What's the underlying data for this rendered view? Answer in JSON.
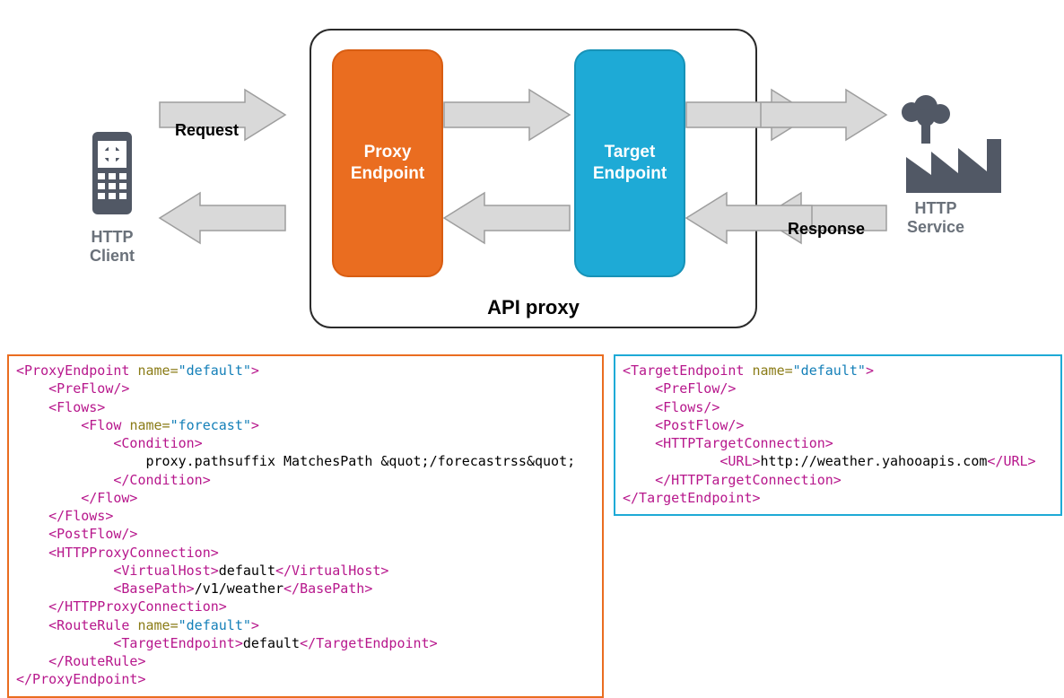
{
  "diagram": {
    "client_label": "HTTP\nClient",
    "service_label": "HTTP\nService",
    "request_label": "Request",
    "response_label": "Response",
    "proxy_box": "Proxy\nEndpoint",
    "target_box": "Target\nEndpoint",
    "api_proxy_label": "API proxy"
  },
  "colors": {
    "proxy": "#ea6d20",
    "target": "#1eaad6",
    "icon_gray": "#515865",
    "arrow_fill": "#d9d9d9",
    "arrow_stroke": "#9e9e9e"
  },
  "proxy_code": [
    {
      "indent": 0,
      "seg": [
        {
          "c": "t",
          "v": "<ProxyEndpoint "
        },
        {
          "c": "an",
          "v": "name="
        },
        {
          "c": "av",
          "v": "\"default\""
        },
        {
          "c": "t",
          "v": ">"
        }
      ]
    },
    {
      "indent": 1,
      "seg": [
        {
          "c": "t",
          "v": "<PreFlow/>"
        }
      ]
    },
    {
      "indent": 1,
      "seg": [
        {
          "c": "t",
          "v": "<Flows>"
        }
      ]
    },
    {
      "indent": 2,
      "seg": [
        {
          "c": "t",
          "v": "<Flow "
        },
        {
          "c": "an",
          "v": "name="
        },
        {
          "c": "av",
          "v": "\"forecast\""
        },
        {
          "c": "t",
          "v": ">"
        }
      ]
    },
    {
      "indent": 3,
      "seg": [
        {
          "c": "t",
          "v": "<Condition>"
        }
      ]
    },
    {
      "indent": 4,
      "seg": [
        {
          "c": "tx",
          "v": "proxy.pathsuffix MatchesPath &quot;/forecastrss&quot;"
        }
      ]
    },
    {
      "indent": 3,
      "seg": [
        {
          "c": "t",
          "v": "</Condition>"
        }
      ]
    },
    {
      "indent": 2,
      "seg": [
        {
          "c": "t",
          "v": "</Flow>"
        }
      ]
    },
    {
      "indent": 1,
      "seg": [
        {
          "c": "t",
          "v": "</Flows>"
        }
      ]
    },
    {
      "indent": 1,
      "seg": [
        {
          "c": "t",
          "v": "<PostFlow/>"
        }
      ]
    },
    {
      "indent": 1,
      "seg": [
        {
          "c": "t",
          "v": "<HTTPProxyConnection>"
        }
      ]
    },
    {
      "indent": 3,
      "seg": [
        {
          "c": "t",
          "v": "<VirtualHost>"
        },
        {
          "c": "tx",
          "v": "default"
        },
        {
          "c": "t",
          "v": "</VirtualHost>"
        }
      ]
    },
    {
      "indent": 3,
      "seg": [
        {
          "c": "t",
          "v": "<BasePath>"
        },
        {
          "c": "tx",
          "v": "/v1/weather"
        },
        {
          "c": "t",
          "v": "</BasePath>"
        }
      ]
    },
    {
      "indent": 1,
      "seg": [
        {
          "c": "t",
          "v": "</HTTPProxyConnection>"
        }
      ]
    },
    {
      "indent": 1,
      "seg": [
        {
          "c": "t",
          "v": "<RouteRule "
        },
        {
          "c": "an",
          "v": "name="
        },
        {
          "c": "av",
          "v": "\"default\""
        },
        {
          "c": "t",
          "v": ">"
        }
      ]
    },
    {
      "indent": 3,
      "seg": [
        {
          "c": "t",
          "v": "<TargetEndpoint>"
        },
        {
          "c": "tx",
          "v": "default"
        },
        {
          "c": "t",
          "v": "</TargetEndpoint>"
        }
      ]
    },
    {
      "indent": 1,
      "seg": [
        {
          "c": "t",
          "v": "</RouteRule>"
        }
      ]
    },
    {
      "indent": 0,
      "seg": [
        {
          "c": "t",
          "v": "</ProxyEndpoint>"
        }
      ]
    }
  ],
  "target_code": [
    {
      "indent": 0,
      "seg": [
        {
          "c": "t",
          "v": "<TargetEndpoint "
        },
        {
          "c": "an",
          "v": "name="
        },
        {
          "c": "av",
          "v": "\"default\""
        },
        {
          "c": "t",
          "v": ">"
        }
      ]
    },
    {
      "indent": 1,
      "seg": [
        {
          "c": "t",
          "v": "<PreFlow/>"
        }
      ]
    },
    {
      "indent": 1,
      "seg": [
        {
          "c": "t",
          "v": "<Flows/>"
        }
      ]
    },
    {
      "indent": 1,
      "seg": [
        {
          "c": "t",
          "v": "<PostFlow/>"
        }
      ]
    },
    {
      "indent": 1,
      "seg": [
        {
          "c": "t",
          "v": "<HTTPTargetConnection>"
        }
      ]
    },
    {
      "indent": 3,
      "seg": [
        {
          "c": "t",
          "v": "<URL>"
        },
        {
          "c": "tx",
          "v": "http://weather.yahooapis.com"
        },
        {
          "c": "t",
          "v": "</URL>"
        }
      ]
    },
    {
      "indent": 1,
      "seg": [
        {
          "c": "t",
          "v": "</HTTPTargetConnection>"
        }
      ]
    },
    {
      "indent": 0,
      "seg": [
        {
          "c": "t",
          "v": "</TargetEndpoint>"
        }
      ]
    }
  ]
}
